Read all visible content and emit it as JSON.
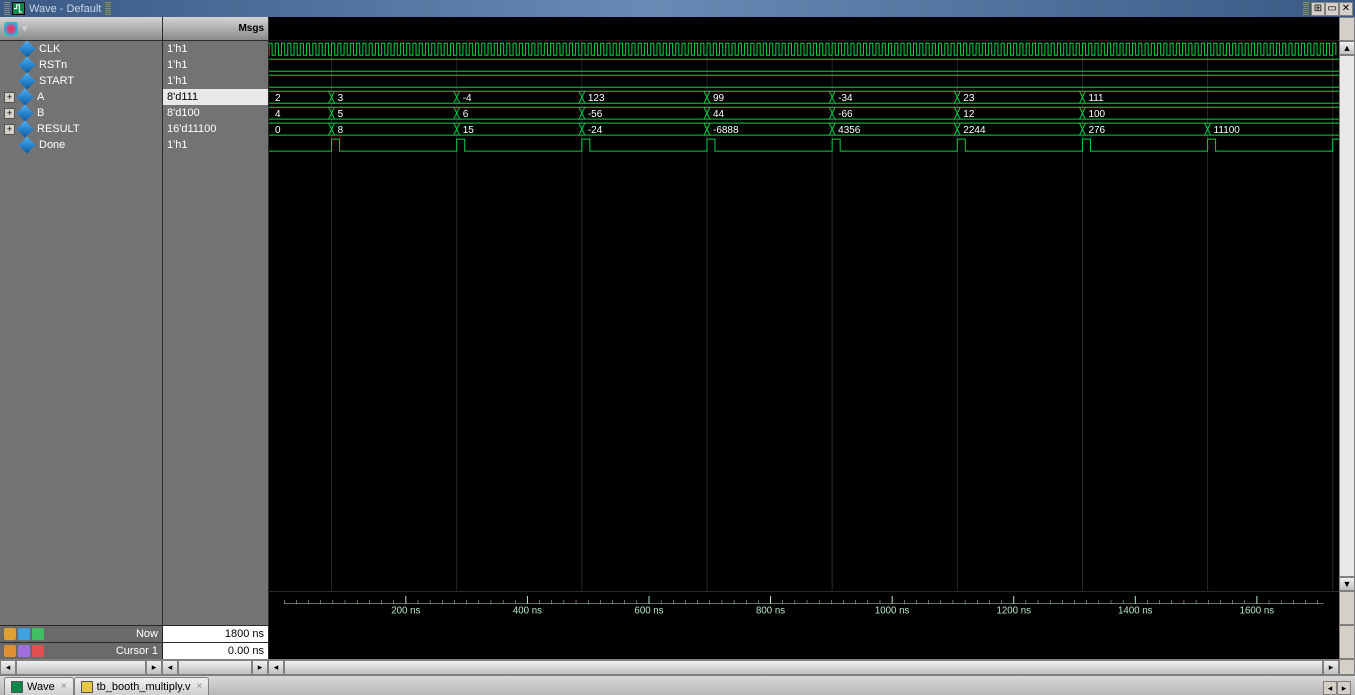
{
  "title": "Wave - Default",
  "columns": {
    "msgs_header": "Msgs"
  },
  "signals": [
    {
      "name": "CLK",
      "value": "1'h1",
      "kind": "clock",
      "expand": null
    },
    {
      "name": "RSTn",
      "value": "1'h1",
      "kind": "high",
      "expand": null
    },
    {
      "name": "START",
      "value": "1'h1",
      "kind": "high",
      "expand": null
    },
    {
      "name": "A",
      "value": "8'd111",
      "kind": "bus",
      "expand": "+",
      "hilite": true,
      "segments": [
        {
          "t": 0,
          "label": "2"
        },
        {
          "t": 100,
          "label": "3"
        },
        {
          "t": 300,
          "label": "-4"
        },
        {
          "t": 500,
          "label": "123"
        },
        {
          "t": 700,
          "label": "99"
        },
        {
          "t": 900,
          "label": "-34"
        },
        {
          "t": 1100,
          "label": "23"
        },
        {
          "t": 1300,
          "label": "111"
        }
      ]
    },
    {
      "name": "B",
      "value": "8'd100",
      "kind": "bus",
      "expand": "+",
      "segments": [
        {
          "t": 0,
          "label": "4"
        },
        {
          "t": 100,
          "label": "5"
        },
        {
          "t": 300,
          "label": "6"
        },
        {
          "t": 500,
          "label": "-56"
        },
        {
          "t": 700,
          "label": "44"
        },
        {
          "t": 900,
          "label": "-66"
        },
        {
          "t": 1100,
          "label": "12"
        },
        {
          "t": 1300,
          "label": "100"
        }
      ]
    },
    {
      "name": "RESULT",
      "value": "16'd11100",
      "kind": "bus",
      "expand": "+",
      "segments": [
        {
          "t": 0,
          "label": "0"
        },
        {
          "t": 100,
          "label": "8"
        },
        {
          "t": 300,
          "label": "15"
        },
        {
          "t": 500,
          "label": "-24"
        },
        {
          "t": 700,
          "label": "-6888"
        },
        {
          "t": 900,
          "label": "4356"
        },
        {
          "t": 1100,
          "label": "2244"
        },
        {
          "t": 1300,
          "label": "276"
        },
        {
          "t": 1500,
          "label": "11100"
        }
      ]
    },
    {
      "name": "Done",
      "value": "1'h1",
      "kind": "pulse",
      "expand": null,
      "pulses": [
        100,
        300,
        500,
        700,
        900,
        1100,
        1300,
        1500,
        1700
      ]
    }
  ],
  "time": {
    "start": 0,
    "end": 1710,
    "ticks": [
      200,
      400,
      600,
      800,
      1000,
      1200,
      1400,
      1600
    ],
    "unit": "ns",
    "guides": [
      100,
      300,
      500,
      700,
      900,
      1100,
      1300,
      1500,
      1700
    ]
  },
  "footer": {
    "now_label": "Now",
    "now_value": "1800 ns",
    "cursor_label": "Cursor 1",
    "cursor_value": "0.00 ns"
  },
  "tabs": [
    {
      "label": "Wave",
      "icon_color": "#0a8a4a"
    },
    {
      "label": "tb_booth_multiply.v",
      "icon_color": "#e8c840"
    }
  ]
}
